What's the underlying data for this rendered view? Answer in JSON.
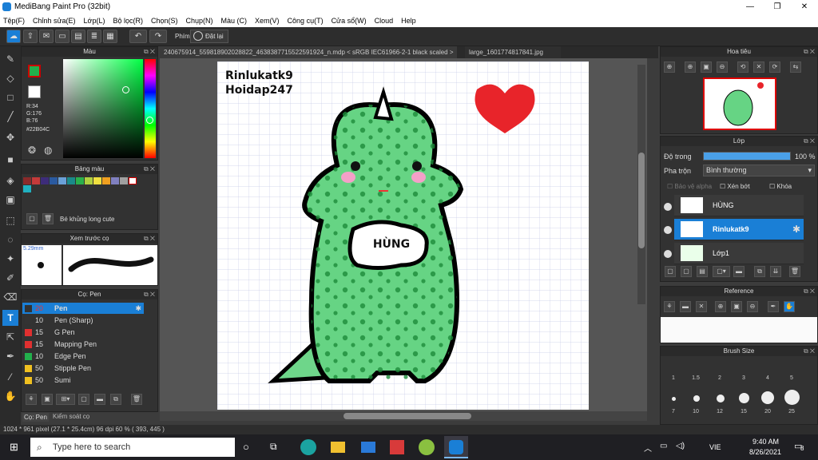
{
  "window": {
    "title": "MediBang Paint Pro (32bit)",
    "min": "—",
    "max": "❐",
    "close": "✕"
  },
  "menu": [
    "Tệp(F)",
    "Chỉnh sửa(E)",
    "Lớp(L)",
    "Bộ lọc(R)",
    "Chọn(S)",
    "Chụp(N)",
    "Màu (C)",
    "Xem(V)",
    "Công cụ(T)",
    "Cửa sổ(W)",
    "Cloud",
    "Help"
  ],
  "toolbar": {
    "snap_label": "Phím",
    "snap_off": "Đặt lại"
  },
  "color_panel": {
    "title": "Màu",
    "r": "R:34",
    "g": "G:176",
    "b": "B:76",
    "hex": "#22B04C",
    "fg": "#22B04C"
  },
  "palette_panel": {
    "title": "Bảng màu",
    "palette_name": "Bé khủng long cute",
    "swatches": [
      "#8a2a2a",
      "#c43a3a",
      "#3d2c7a",
      "#2a5aa0",
      "#6aa0d8",
      "#1a8a8a",
      "#2ab04c",
      "#b0d040",
      "#f0e040",
      "#f0a020",
      "#8080c0",
      "#a0a0a0",
      "#ffffff",
      "#20b0c0"
    ]
  },
  "preview_panel": {
    "title": "Xem trước cọ",
    "size": "5.29mm"
  },
  "brush_panel": {
    "title": "Cọ: Pen",
    "items": [
      {
        "size": "20",
        "name": "Pen",
        "color": "#333333"
      },
      {
        "size": "10",
        "name": "Pen (Sharp)",
        "color": "#333333"
      },
      {
        "size": "15",
        "name": "G Pen",
        "color": "#e03030"
      },
      {
        "size": "15",
        "name": "Mapping Pen",
        "color": "#e03030"
      },
      {
        "size": "10",
        "name": "Edge Pen",
        "color": "#22b04c"
      },
      {
        "size": "50",
        "name": "Stipple Pen",
        "color": "#f0c020"
      },
      {
        "size": "50",
        "name": "Sumi",
        "color": "#f0c020"
      }
    ],
    "tab1": "Cọ: Pen",
    "tab2": "Kiểm soát cọ"
  },
  "tabs": {
    "doc1": "240675914_559818902028822_4638387715522591924_n.mdp < sRGB IEC61966-2-1 black scaled >",
    "doc2": "large_1601774817841.jpg"
  },
  "canvas": {
    "text1": "Rinlukatk9",
    "text2": "Hoidap247",
    "label": "HÙNG"
  },
  "navigator": {
    "title": "Hoa tiêu"
  },
  "layer_panel": {
    "title": "Lớp",
    "opacity_label": "Độ trong",
    "opacity": "100 %",
    "opacity_pct": 100,
    "blend_label": "Pha trộn",
    "blend": "Bình thường",
    "alpha": "Bảo vệ alpha",
    "clip": "Xén bớt",
    "lock": "Khóa",
    "layers": [
      {
        "name": "HÙNG"
      },
      {
        "name": "Rinlukatk9"
      },
      {
        "name": "Lớp1"
      }
    ]
  },
  "reference_panel": {
    "title": "Reference"
  },
  "brushsize_panel": {
    "title": "Brush Size",
    "row1": [
      "1",
      "1.5",
      "2",
      "3",
      "4",
      "5"
    ],
    "row2": [
      "7",
      "10",
      "12",
      "15",
      "20",
      "25"
    ]
  },
  "status": {
    "text": "1024 * 961 pixel   (27.1 * 25.4cm)   96 dpi   60 %   ( 393, 445 )"
  },
  "taskbar": {
    "search": "Type here to search",
    "time": "9:40 AM",
    "date": "8/26/2021",
    "lang": "VIE",
    "notif": "8"
  }
}
